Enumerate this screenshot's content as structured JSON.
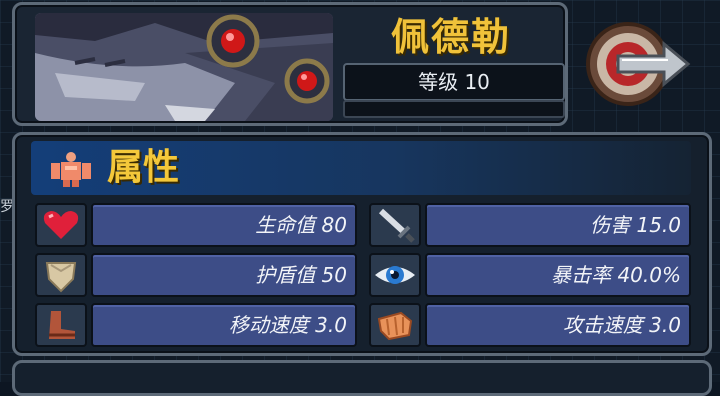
{
  "character": {
    "name": "佩德勒",
    "level_text": "等级 10"
  },
  "attributes": {
    "title": "属性",
    "stats": [
      {
        "icon": "heart-icon",
        "text": "生命值 80"
      },
      {
        "icon": "sword-icon",
        "text": "伤害 15.0"
      },
      {
        "icon": "shield-icon",
        "text": "护盾值 50"
      },
      {
        "icon": "eye-icon",
        "text": "暴击率 40.0%"
      },
      {
        "icon": "boots-icon",
        "text": "移动速度 3.0"
      },
      {
        "icon": "fist-icon",
        "text": "攻击速度 3.0"
      }
    ]
  },
  "side_glyph": "罗",
  "colors": {
    "title_gold": "#f0c23a",
    "stat_bar": "#3d4d87",
    "panel_header_blue": "#143e79",
    "frame": "#5d6a78"
  }
}
